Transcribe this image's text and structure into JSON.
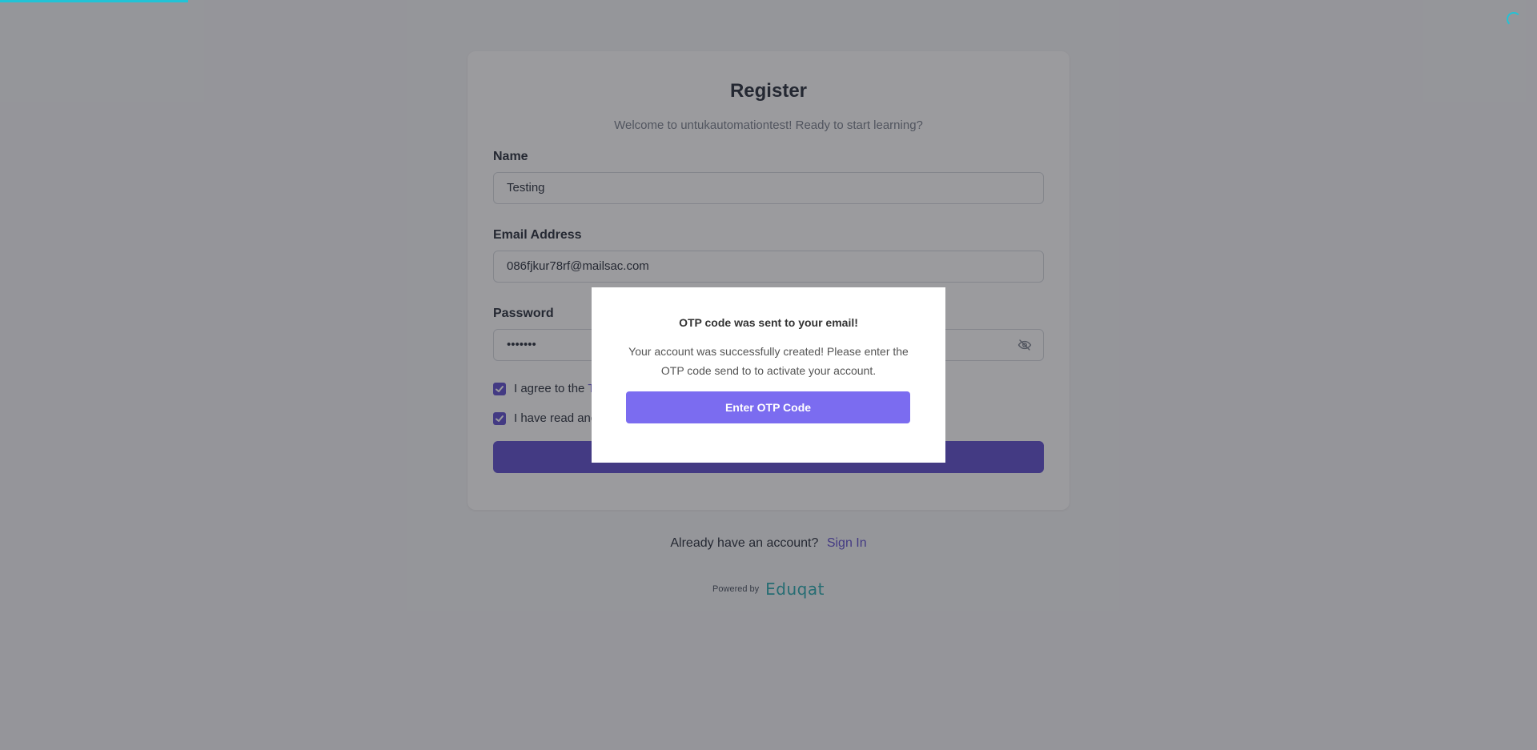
{
  "page": {
    "progress_percent": 12,
    "loading": true
  },
  "register": {
    "title": "Register",
    "subtitle": "Welcome to untukautomationtest! Ready to start learning?",
    "name_label": "Name",
    "name_value": "Testing",
    "email_label": "Email Address",
    "email_value": "086fjkur78rf@mailsac.com",
    "password_label": "Password",
    "password_value": "•••••••",
    "terms_prefix": "I agree to the",
    "terms_link_visible": "Te",
    "privacy_prefix": "I have read and",
    "terms_checked": true,
    "privacy_checked": true
  },
  "footer": {
    "have_account": "Already have an account?",
    "sign_in": "Sign In",
    "powered_by": "Powered by",
    "brand": "Eduqat"
  },
  "modal": {
    "title": "OTP code was sent to your email!",
    "message": "Your account was successfully created! Please enter the OTP code send to to activate your account.",
    "button": "Enter OTP Code"
  },
  "colors": {
    "accent": "#4f3cc9",
    "modal_button": "#7b6cf0",
    "progress": "#22c3d6",
    "brand": "#14a3a8"
  },
  "icons": {
    "password_toggle": "eye-slash-icon",
    "checkbox": "check-icon"
  }
}
